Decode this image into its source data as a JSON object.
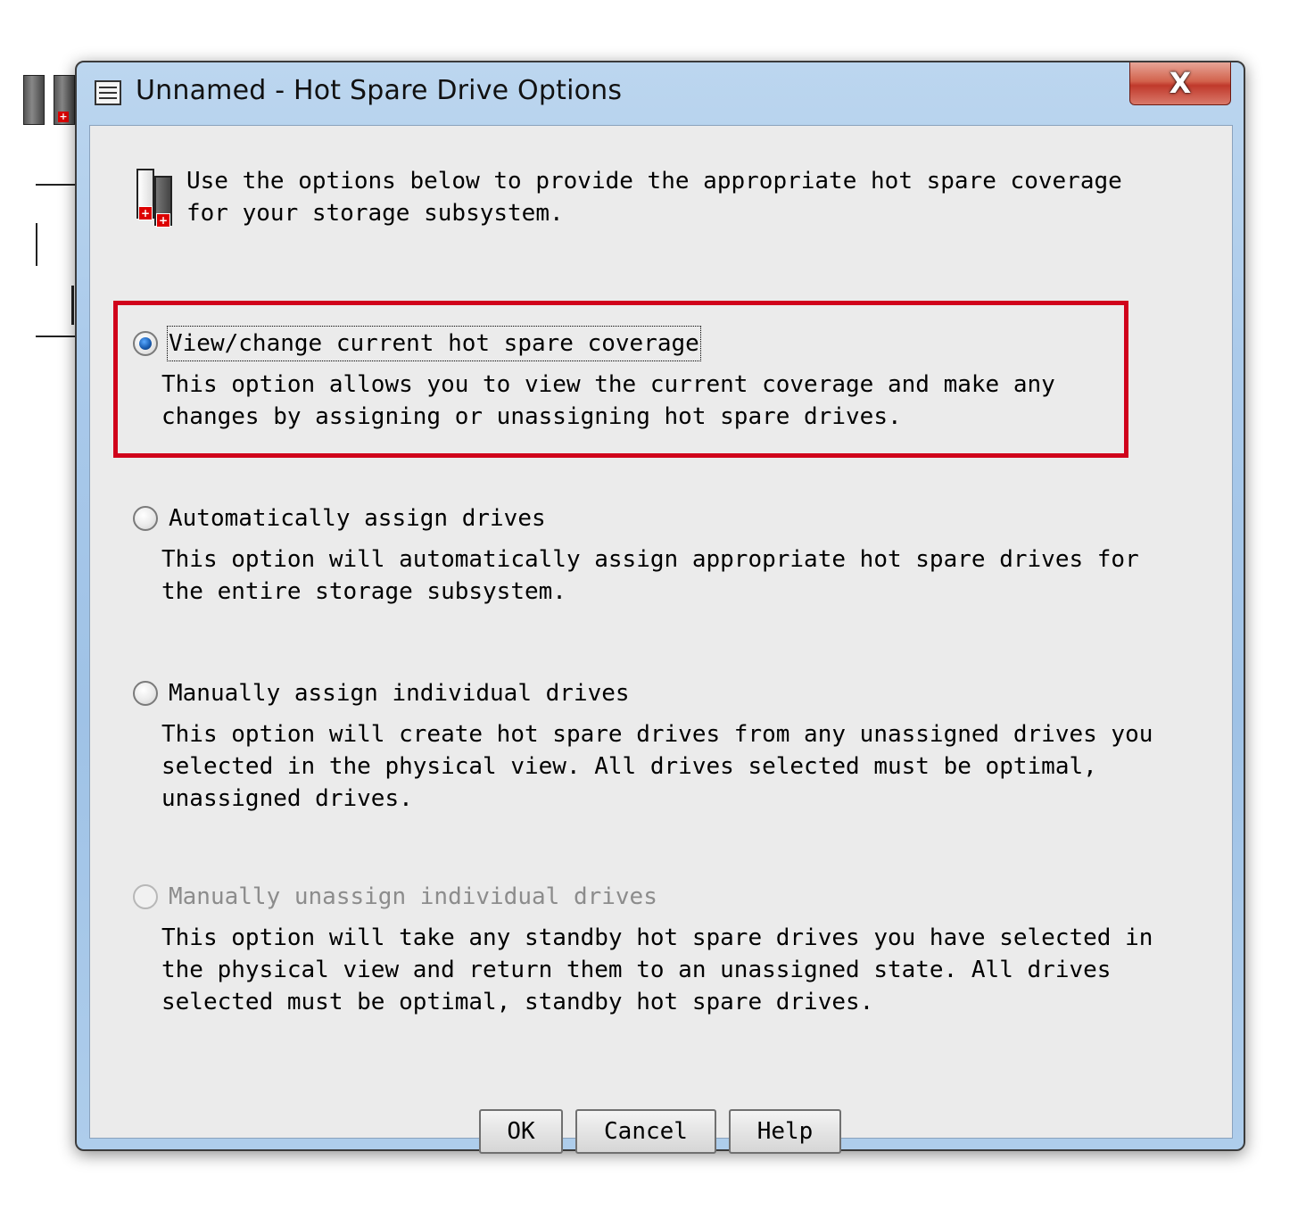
{
  "window": {
    "title": "Unnamed - Hot Spare Drive Options",
    "close_label": "X"
  },
  "intro": {
    "text": "Use the options below to provide the appropriate hot spare coverage\nfor your storage subsystem."
  },
  "options": [
    {
      "label": "View/change current hot spare coverage",
      "description": "This option allows you to view the current coverage and make any\nchanges by assigning or unassigning hot spare drives.",
      "selected": true,
      "enabled": true
    },
    {
      "label": "Automatically assign drives",
      "description": "This option will automatically assign appropriate hot spare drives for\nthe entire storage subsystem.",
      "selected": false,
      "enabled": true
    },
    {
      "label": "Manually assign individual drives",
      "description": "This option will create hot spare drives from any unassigned drives you\nselected in the physical view. All drives selected must be optimal,\nunassigned drives.",
      "selected": false,
      "enabled": true
    },
    {
      "label": "Manually unassign individual drives",
      "description": "This option will take any standby hot spare drives you have selected in\nthe physical view and return them to an unassigned state. All drives\nselected must be optimal, standby hot spare drives.",
      "selected": false,
      "enabled": false
    }
  ],
  "buttons": {
    "ok": "OK",
    "cancel": "Cancel",
    "help": "Help"
  },
  "colors": {
    "highlight": "#d0021b",
    "client_bg": "#ebebeb",
    "titlebar": "#a9c9ea",
    "disabled_text": "#8c8c8c"
  }
}
